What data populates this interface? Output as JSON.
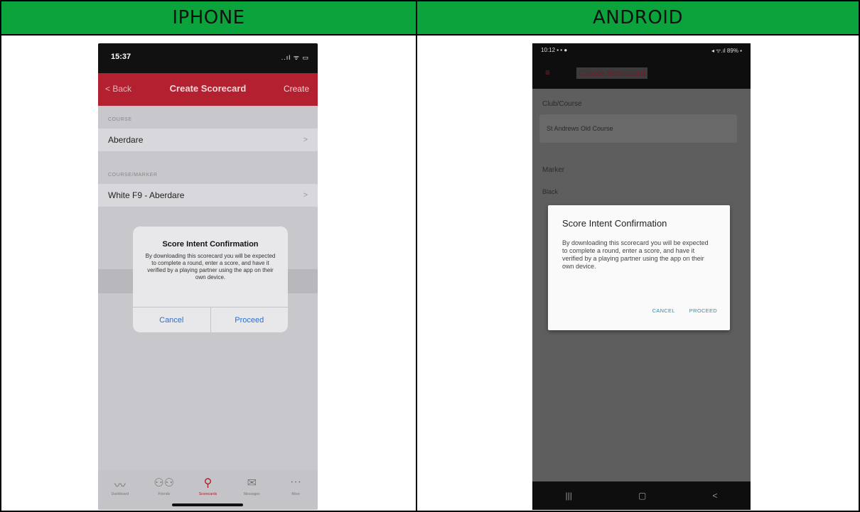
{
  "headers": {
    "left": "IPHONE",
    "right": "ANDROID"
  },
  "iphone": {
    "status": {
      "time": "15:37",
      "icons": "..ıl ᯤ ▭"
    },
    "nav": {
      "back": "< Back",
      "title": "Create Scorecard",
      "create": "Create"
    },
    "course_section": "COURSE",
    "course_value": "Aberdare",
    "marker_section": "COURSE/MARKER",
    "marker_value": "White F9 - Aberdare",
    "chevron": ">",
    "alert": {
      "title": "Score Intent Confirmation",
      "body": "By downloading this scorecard you will be expected to complete a round, enter a score, and have it verified by a playing partner using the app on their own device.",
      "cancel": "Cancel",
      "proceed": "Proceed"
    },
    "tabs": [
      {
        "icon": "〰",
        "label": "Dashboard"
      },
      {
        "icon": "⚇⚇",
        "label": "Friends"
      },
      {
        "icon": "⚲",
        "label": "Scorecards"
      },
      {
        "icon": "✉",
        "label": "Messages"
      },
      {
        "icon": "···",
        "label": "More"
      }
    ]
  },
  "android": {
    "status": {
      "time": "10:12 ▪ ▪ ●",
      "icons": "◂ ᯤ.ıl 89% ▪"
    },
    "menu_icon": "≡",
    "title": "Create Scorecard",
    "club_label": "Club/Course",
    "club_value": "St Andrews Old Course",
    "marker_label": "Marker",
    "marker_value": "Black",
    "dialog": {
      "title": "Score Intent Confirmation",
      "body": "By downloading this scorecard you will be expected to complete a round, enter a score, and have it verified by a playing partner using the app on their own device.",
      "cancel": "CANCEL",
      "proceed": "PROCEED"
    },
    "navbar": {
      "recents": "|||",
      "home": "▢",
      "back": "<"
    }
  },
  "colors": {
    "header_green": "#0ba33c",
    "ios_red": "#b3202f",
    "ios_blue": "#2d6ed0",
    "android_teal": "#2f8fb0"
  }
}
